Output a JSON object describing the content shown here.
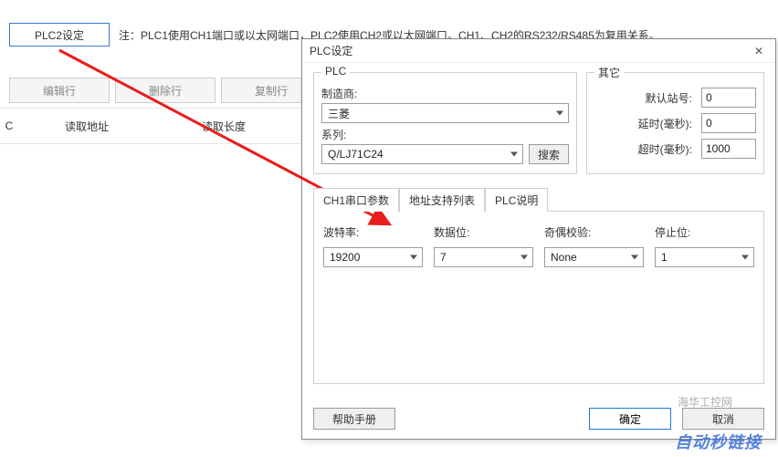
{
  "bg": {
    "plc2_button": "PLC2设定",
    "note": "注：PLC1使用CH1端口或以太网端口，PLC2使用CH2或以太网端口。CH1、CH2的RS232/RS485为复用关系。",
    "toolbar": {
      "edit": "编辑行",
      "delete": "删除行",
      "copy": "复制行"
    },
    "columns": {
      "c": "C",
      "read_addr": "读取地址",
      "read_len": "读取长度"
    }
  },
  "dialog": {
    "title": "PLC设定",
    "close": "✕",
    "plc_group_title": "PLC",
    "other_group_title": "其它",
    "maker_label": "制造商:",
    "maker_value": "三菱",
    "series_label": "系列:",
    "series_value": "Q/LJ71C24",
    "search_btn": "搜索",
    "default_station_label": "默认站号:",
    "default_station_value": "0",
    "delay_label": "延时(毫秒):",
    "delay_value": "0",
    "timeout_label": "超时(毫秒):",
    "timeout_value": "1000",
    "tabs": {
      "serial": "CH1串口参数",
      "addr_list": "地址支持列表",
      "plc_desc": "PLC说明"
    },
    "serial": {
      "baud_label": "波特率:",
      "baud_value": "19200",
      "data_bits_label": "数据位:",
      "data_bits_value": "7",
      "parity_label": "奇偶校验:",
      "parity_value": "None",
      "stop_bits_label": "停止位:",
      "stop_bits_value": "1"
    },
    "footer": {
      "help": "帮助手册",
      "ok": "确定",
      "cancel": "取消"
    }
  },
  "watermarks": {
    "top": "海华工控网",
    "bottom": "自动秒链接"
  }
}
